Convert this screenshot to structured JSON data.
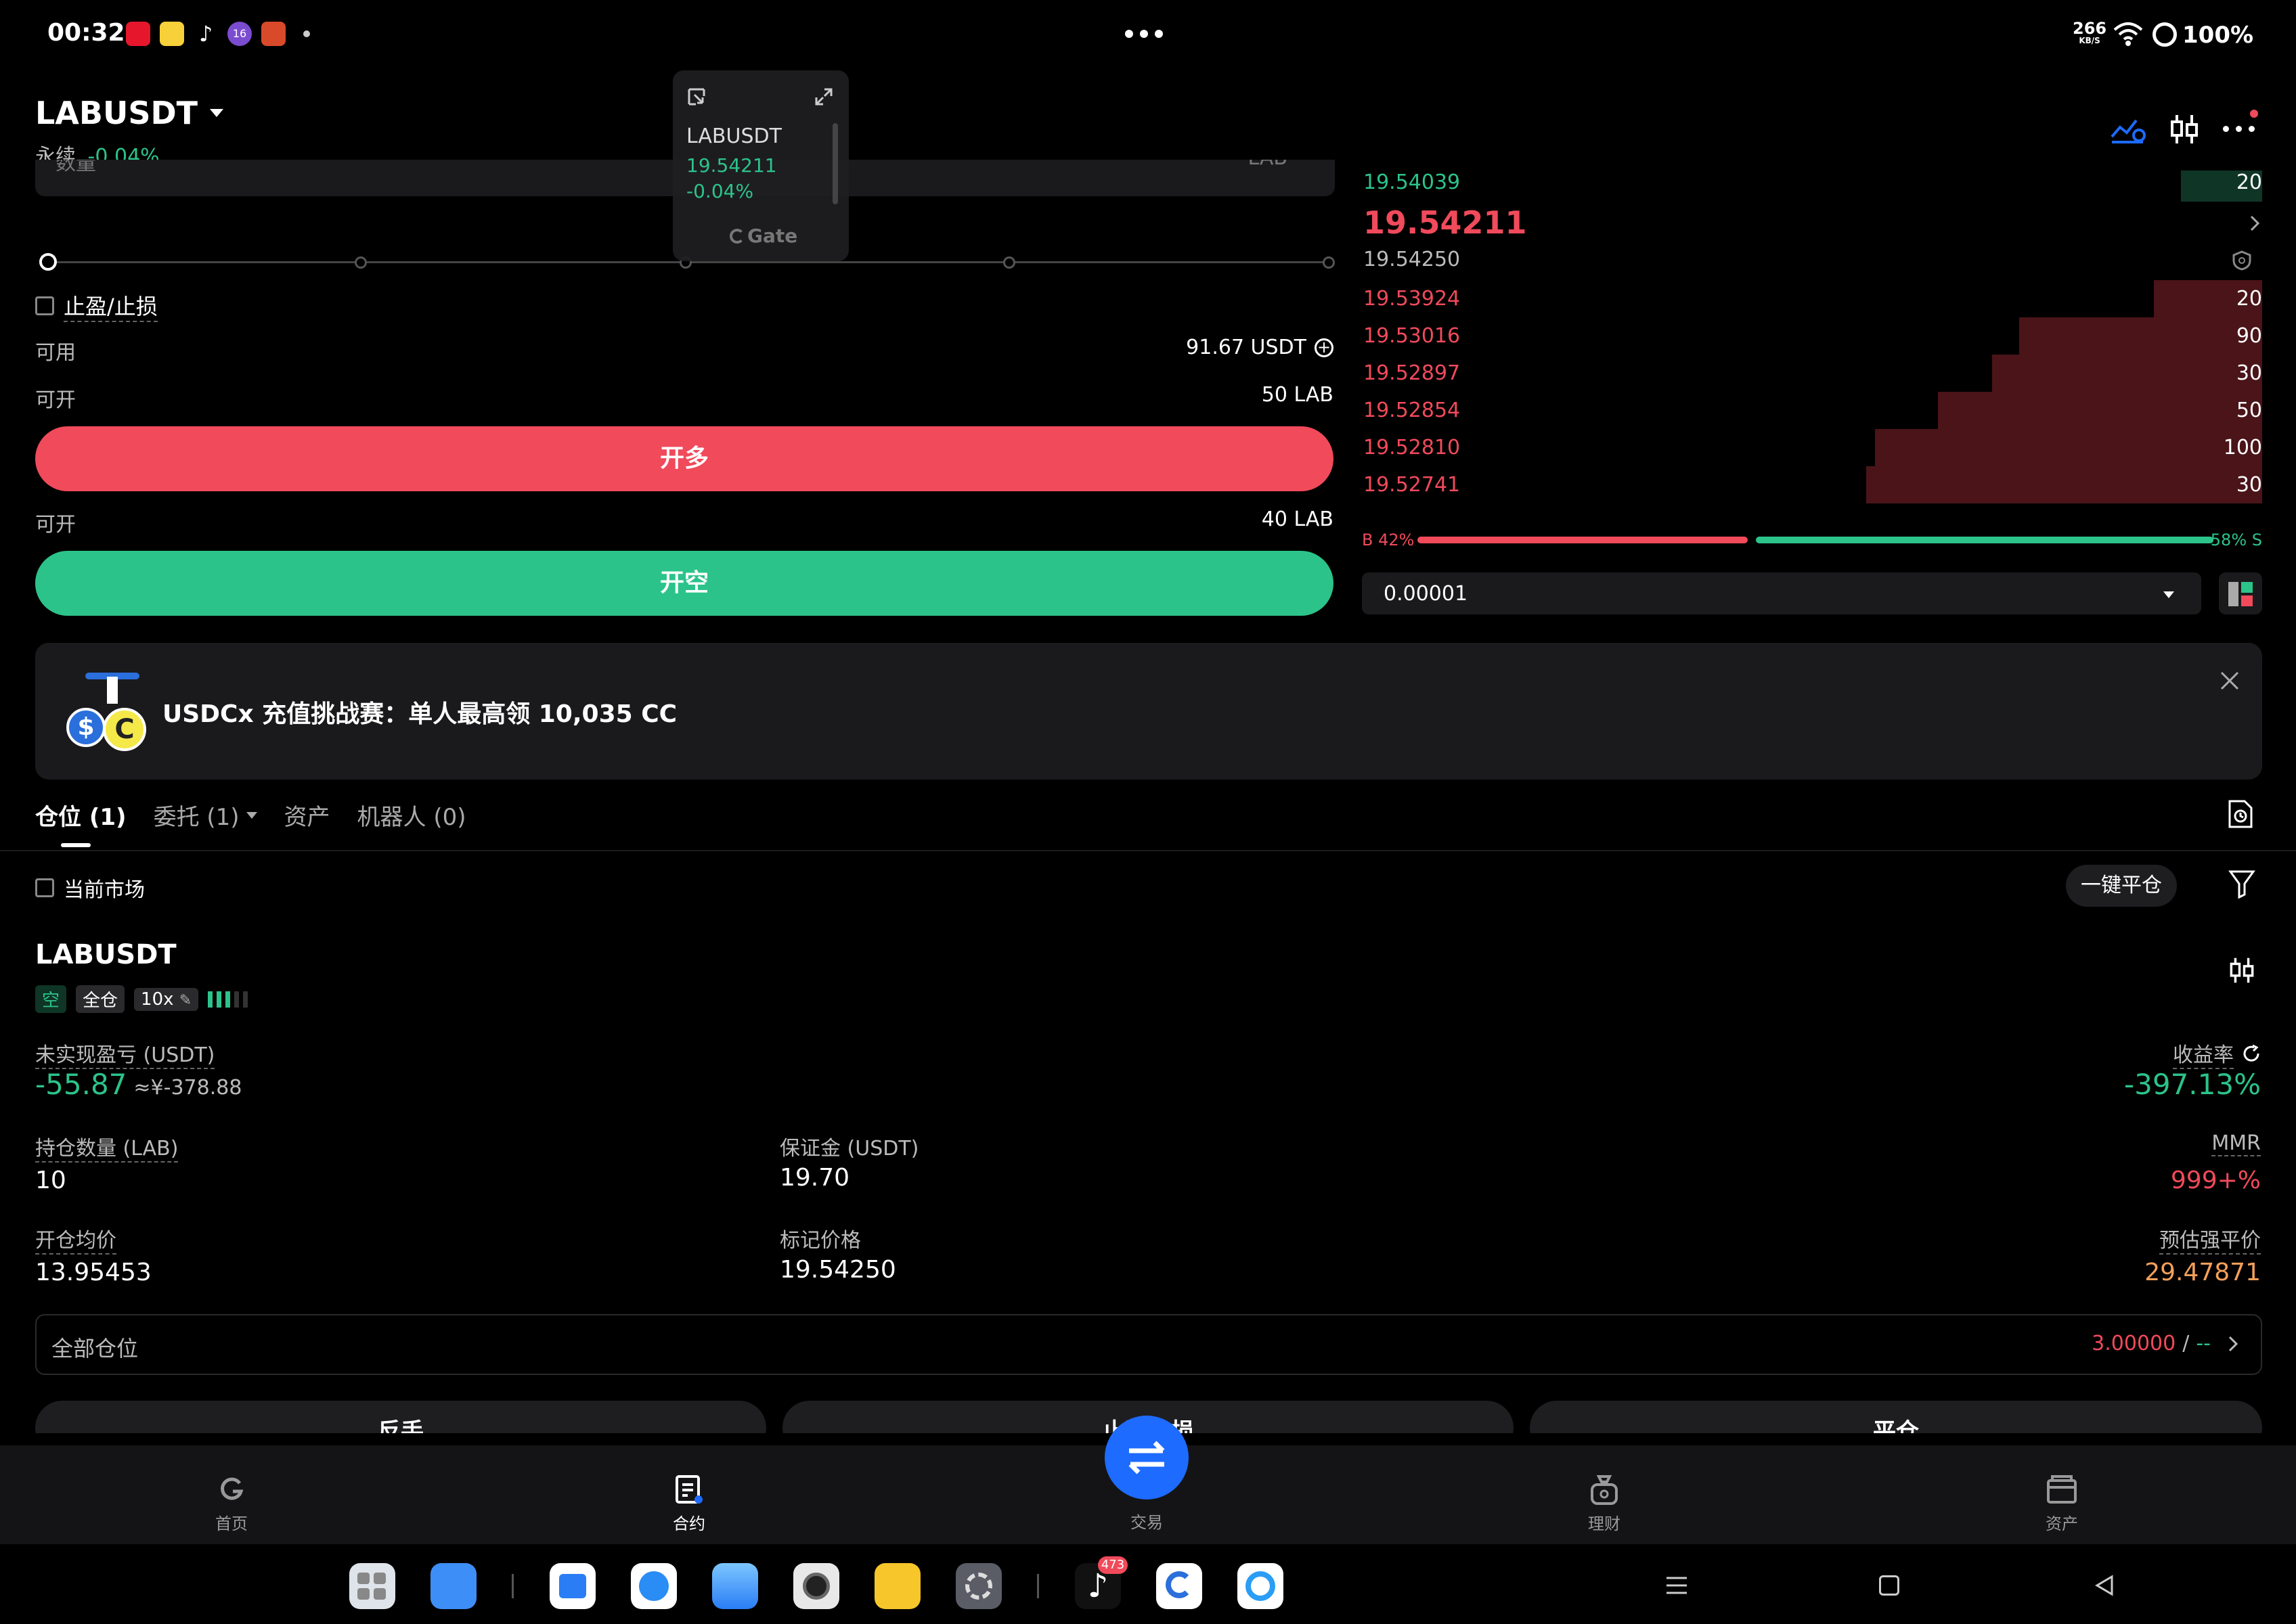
{
  "status_bar": {
    "time": "00:32",
    "net_speed_top": "266",
    "net_speed_bottom": "KB/S",
    "battery": "100%",
    "app_badge": "16"
  },
  "header": {
    "pair": "LABUSDT",
    "type": "永续",
    "change": "-0.04%"
  },
  "float_window": {
    "pair": "LABUSDT",
    "price": "19.54211",
    "change": "-0.04%",
    "brand": "Gate"
  },
  "order_form": {
    "qty_partial_label": "数量",
    "qty_partial_unit": "LAB",
    "tp_sl_label": "止盈/止损",
    "available_label": "可用",
    "available_value": "91.67 USDT",
    "can_open_label": "可开",
    "can_open_long": "50 LAB",
    "long_button": "开多",
    "can_open_short": "40 LAB",
    "short_button": "开空"
  },
  "orderbook": {
    "ask_top_price": "19.54039",
    "ask_top_qty": "20",
    "last_price": "19.54211",
    "mark_price": "19.54250",
    "bids": [
      {
        "price": "19.53924",
        "qty": "20",
        "depth": 0.12
      },
      {
        "price": "19.53016",
        "qty": "90",
        "depth": 0.27
      },
      {
        "price": "19.52897",
        "qty": "30",
        "depth": 0.3
      },
      {
        "price": "19.52854",
        "qty": "50",
        "depth": 0.36
      },
      {
        "price": "19.52810",
        "qty": "100",
        "depth": 0.43
      },
      {
        "price": "19.52741",
        "qty": "30",
        "depth": 0.44
      }
    ],
    "buy_ratio_label": "B 42%",
    "sell_ratio_label": "58% S",
    "buy_ratio": 0.42,
    "precision": "0.00001"
  },
  "banner": {
    "text": "USDCx 充值挑战赛：单人最高领 10,035 CC"
  },
  "tabs": [
    {
      "label": "仓位 (1)"
    },
    {
      "label": "委托 (1)"
    },
    {
      "label": "资产"
    },
    {
      "label": "机器人 (0)"
    }
  ],
  "positions": {
    "current_market_label": "当前市场",
    "close_all_button": "一键平仓",
    "pair": "LABUSDT",
    "side_tag": "空",
    "margin_tag": "全仓",
    "leverage_tag": "10x",
    "unrealized_label": "未实现盈亏 (USDT)",
    "unrealized_value": "-55.87",
    "unrealized_cny": "≈¥-378.88",
    "roi_label": "收益率",
    "roi_value": "-397.13%",
    "qty_label": "持仓数量 (LAB)",
    "qty_value": "10",
    "margin_label": "保证金 (USDT)",
    "margin_value": "19.70",
    "mmr_label": "MMR",
    "mmr_value": "999+%",
    "entry_label": "开仓均价",
    "entry_value": "13.95453",
    "mark_label": "标记价格",
    "mark_value": "19.54250",
    "liq_label": "预估强平价",
    "liq_value": "29.47871",
    "all_positions_label": "全部仓位",
    "all_positions_value_red": "3.00000",
    "all_positions_sep": "/",
    "all_positions_value_green": "--",
    "btn_reverse": "反手",
    "btn_tpsl": "止盈止损",
    "btn_close": "平仓"
  },
  "bottom_nav": [
    {
      "label": "首页"
    },
    {
      "label": "合约"
    },
    {
      "label": "交易"
    },
    {
      "label": "理财"
    },
    {
      "label": "资产"
    }
  ],
  "dock": {
    "tiktok_badge": "473"
  },
  "colors": {
    "red": "#f04a5b",
    "green": "#2cc38a",
    "blue": "#1d6bff",
    "panel": "#1a1a1c",
    "liq_orange": "#f5a05a"
  }
}
